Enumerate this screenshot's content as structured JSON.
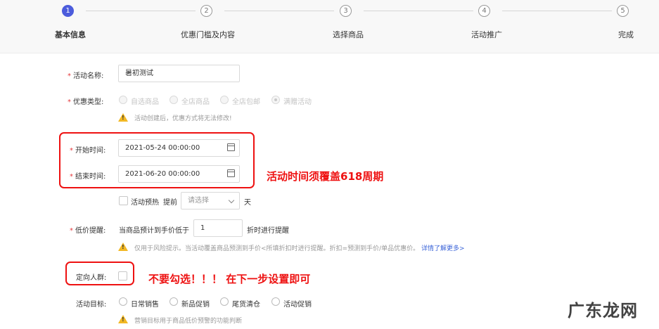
{
  "steps": [
    {
      "num": "1",
      "label": "基本信息",
      "active": true
    },
    {
      "num": "2",
      "label": "优惠门槛及内容",
      "active": false
    },
    {
      "num": "3",
      "label": "选择商品",
      "active": false
    },
    {
      "num": "4",
      "label": "活动推广",
      "active": false
    },
    {
      "num": "5",
      "label": "完成",
      "active": false
    }
  ],
  "form": {
    "required_mark": "*",
    "activity_name": {
      "label": "活动名称:",
      "value": "暑初测试"
    },
    "promo_type": {
      "label": "优惠类型:",
      "options": [
        "自选商品",
        "全店商品",
        "全店包邮",
        "满赠活动"
      ],
      "selected": "满赠活动",
      "warning": "活动创建后，优惠方式将无法修改!"
    },
    "start_time": {
      "label": "开始时间:",
      "value": "2021-05-24 00:00:00"
    },
    "end_time": {
      "label": "结束时间:",
      "value": "2021-06-20 00:00:00"
    },
    "preheat": {
      "checkbox_label": "活动预热",
      "prefix": "提前",
      "select_placeholder": "请选择",
      "suffix": "天"
    },
    "low_price": {
      "label": "低价提醒:",
      "prefix": "当商品预计到手价低于",
      "value": "1",
      "suffix": "折时进行提醒",
      "warning": "仅用于风险提示。当活动覆盖商品预测到手价<所填折扣时进行提醒。折扣=预测到手价/单品优惠价。",
      "link": "详情了解更多>"
    },
    "target_crowd": {
      "label": "定向人群:"
    },
    "activity_goal": {
      "label": "活动目标:",
      "options": [
        "日常销售",
        "新品促销",
        "尾货清仓",
        "活动促销"
      ],
      "warning": "营销目标用于商品低价预警的功能判断"
    }
  },
  "annotations": {
    "time_note": "活动时间须覆盖618周期",
    "crowd_note": "不要勾选！！！ 在下一步设置即可"
  },
  "watermark": "广东龙网",
  "colors": {
    "accent": "#4c5cdc",
    "annotation": "#e11111",
    "warning": "#f2b824",
    "link": "#3b64d8"
  }
}
